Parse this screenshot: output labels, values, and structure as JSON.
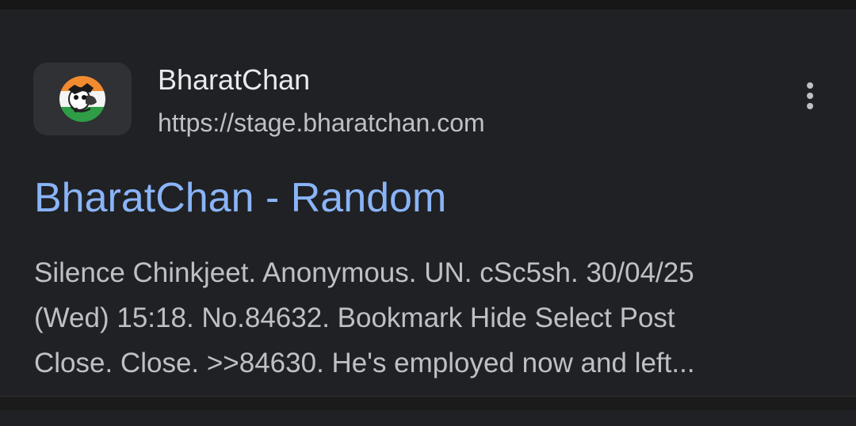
{
  "result": {
    "site_name": "BharatChan",
    "site_url": "https://stage.bharatchan.com",
    "title": "BharatChan - Random",
    "snippet_lines": [
      "Silence Chinkjeet. Anonymous. UN. cSc5sh. 30/04/25",
      "(Wed) 15:18. No.84632. Bookmark Hide Select Post",
      "Close. Close. >>84630. He's employed now and left..."
    ],
    "favicon_icon": "bharatchan-logo-icon",
    "menu_icon": "more-vert-icon"
  },
  "colors": {
    "background": "#202124",
    "title_link": "#8ab4f8",
    "site_name": "#e8eaed",
    "secondary_text": "#bdc1c6",
    "favicon_bg": "#303134"
  }
}
